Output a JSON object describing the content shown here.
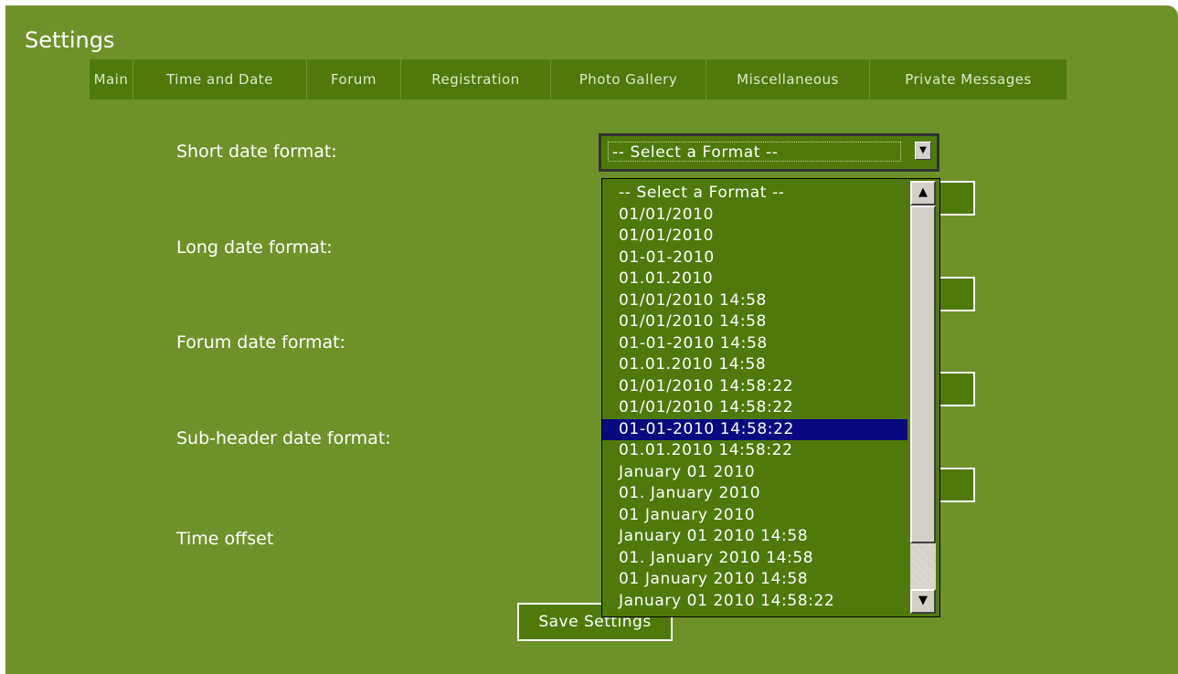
{
  "page": {
    "title": "Settings"
  },
  "tabs": [
    "Main",
    "Time and Date",
    "Forum",
    "Registration",
    "Photo Gallery",
    "Miscellaneous",
    "Private Messages"
  ],
  "form": {
    "labels": {
      "short_date": "Short date format:",
      "long_date": "Long date format:",
      "forum_date": "Forum date format:",
      "subheader_date": "Sub-header date format:",
      "time_offset": "Time offset"
    },
    "select": {
      "value": "-- Select a Format --",
      "arrow_icon": "chevron-down-icon"
    },
    "options": [
      "-- Select a Format --",
      "01/01/2010",
      "01/01/2010",
      "01-01-2010",
      "01.01.2010",
      "01/01/2010 14:58",
      "01/01/2010 14:58",
      "01-01-2010 14:58",
      "01.01.2010 14:58",
      "01/01/2010 14:58:22",
      "01/01/2010 14:58:22",
      "01-01-2010 14:58:22",
      "01.01.2010 14:58:22",
      "January 01 2010",
      "01. January 2010",
      "01 January 2010",
      "January 01 2010 14:58",
      "01. January 2010 14:58",
      "01 January 2010 14:58",
      "January 01 2010 14:58:22"
    ],
    "selected_option": "01-01-2010 14:58:22",
    "save_label": "Save Settings"
  },
  "colors": {
    "panel_bg": "#6f912a",
    "tab_bg": "#4f7a0b",
    "highlight": "#0a0a80"
  }
}
